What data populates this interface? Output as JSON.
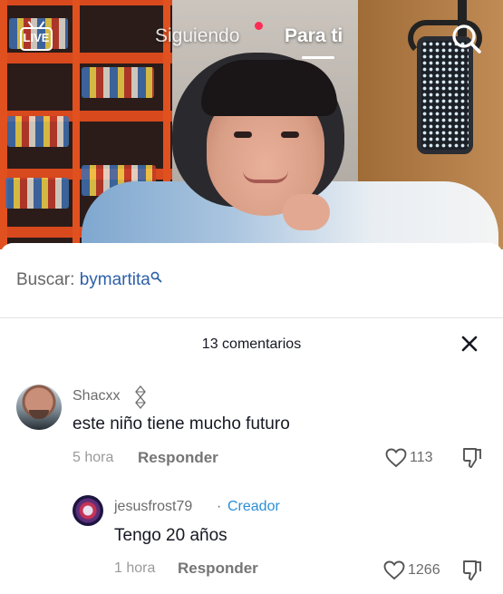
{
  "topnav": {
    "live_label": "LIVE",
    "following_label": "Siguiendo",
    "for_you_label": "Para ti",
    "search_icon": "search-icon"
  },
  "comments_panel": {
    "search_prefix": "Buscar:",
    "search_query": "bymartita",
    "count_label": "13 comentarios",
    "accent_color": "#2d5fa8",
    "creator_color": "#2d8fd5",
    "live_dot_color": "#fe2c55"
  },
  "comments": [
    {
      "username": "Shacxx",
      "text": "este niño tiene mucho futuro",
      "time": "5 hora",
      "reply_label": "Responder",
      "likes": "113"
    }
  ],
  "replies": [
    {
      "username": "jesusfrost79",
      "separator": "·",
      "badge": "Creador",
      "text": "Tengo 20 años",
      "time": "1 hora",
      "reply_label": "Responder",
      "likes": "1266"
    }
  ]
}
